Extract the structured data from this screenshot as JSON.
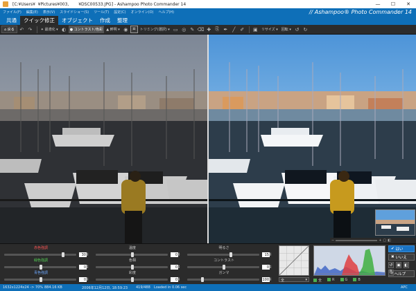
{
  "window": {
    "title": "[C:¥Users¥   ¥Pictures¥003,           ¥DSC00533.JPG] - Ashampoo Photo Commander 14",
    "minimize": "—",
    "maximize": "☐",
    "close": "✕"
  },
  "menu": [
    "ファイル(F)",
    "編集(E)",
    "表示(V)",
    "スライドショー(S)",
    "ツール(T)",
    "設定(C)",
    "オンライン(O)",
    "ヘルプ(H)"
  ],
  "brand": "// Ashampoo® Photo Commander 14",
  "tabs": [
    {
      "label": "共通",
      "active": false
    },
    {
      "label": "クイック修正",
      "active": true
    },
    {
      "label": "オブジェクト",
      "active": false
    },
    {
      "label": "作成",
      "active": false
    },
    {
      "label": "整理",
      "active": false
    }
  ],
  "toolbar": {
    "back": "戻る",
    "auto_fix": "最適化",
    "contrast_color": "コントラスト/色彩",
    "sharpen": "鮮明",
    "crop": "トリミング(選択)",
    "resize": "リサイズ",
    "rotate": "回転"
  },
  "adjustments": {
    "col1": [
      {
        "label": "赤色強調",
        "color": "red",
        "value": "30",
        "pos": 0.8
      },
      {
        "label": "緑色強調",
        "color": "green",
        "value": "0",
        "pos": 0.5
      },
      {
        "label": "青色強調",
        "color": "blue",
        "value": "0",
        "pos": 0.5
      }
    ],
    "col2": [
      {
        "label": "温度",
        "color": "",
        "value": "0",
        "pos": 0.5
      },
      {
        "label": "色相",
        "color": "",
        "value": "0",
        "pos": 0.5
      },
      {
        "label": "彩度",
        "color": "",
        "value": "0",
        "pos": 0.5
      }
    ],
    "col3": [
      {
        "label": "明るさ",
        "color": "",
        "value": "15",
        "pos": 0.6
      },
      {
        "label": "コントラスト",
        "color": "",
        "value": "0",
        "pos": 0.5
      },
      {
        "label": "ガンマ",
        "color": "",
        "value": "100",
        "pos": 0.2
      }
    ]
  },
  "curve_select": "全",
  "histogram_checks": [
    "全",
    "R",
    "G",
    "B"
  ],
  "actions": {
    "yes": "はい",
    "no": "いいえ",
    "help": "ヘルプ"
  },
  "status": {
    "dimensions": "1632x1224x24 -> 70%",
    "filesize": "884.16 KB",
    "date": "2006年12月12日, 18:59:23",
    "index": "419/488",
    "loaded": "Loaded in 0.06 sec",
    "mode": "APC"
  },
  "colors": {
    "accent": "#0e6fb8",
    "panel": "#2b2b2b",
    "yes_button": "#1a73c4"
  }
}
